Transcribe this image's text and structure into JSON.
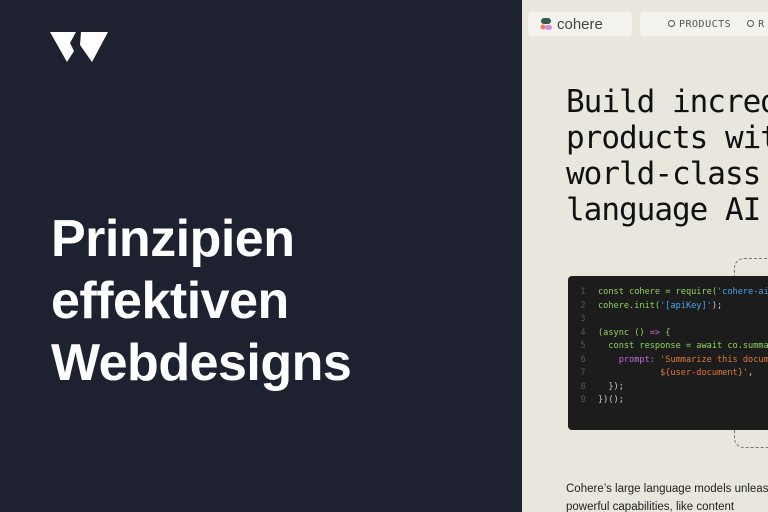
{
  "left": {
    "logo": "W",
    "headline": [
      "Prinzipien",
      "effektiven",
      "Webdesigns"
    ]
  },
  "screenshot": {
    "brand": "cohere",
    "nav": [
      "PRODUCTS",
      "R"
    ],
    "hero": [
      "Build incredi",
      "products with",
      "world-class",
      "language AI"
    ],
    "code": [
      [
        [
          "g",
          "const cohere = require("
        ],
        [
          "b",
          "'cohere-ai'"
        ],
        [
          "w",
          ")"
        ]
      ],
      [
        [
          "g",
          "cohere.init("
        ],
        [
          "b",
          "'[apiKey]'"
        ],
        [
          "w",
          ");"
        ]
      ],
      [],
      [
        [
          "g",
          "(async () "
        ],
        [
          "p",
          "=>"
        ],
        [
          "g",
          " {"
        ]
      ],
      [
        [
          "g",
          "  const response = await co.summari"
        ]
      ],
      [
        [
          "p",
          "    prompt: "
        ],
        [
          "o",
          "'Summarize this documen"
        ]
      ],
      [
        [
          "o",
          "            ${user-document}'"
        ],
        [
          "w",
          ","
        ]
      ],
      [
        [
          "w",
          "  });"
        ]
      ],
      [
        [
          "w",
          "})();"
        ]
      ]
    ],
    "paragraph": [
      "Cohere’s large language models unleas",
      "powerful capabilities, like content"
    ]
  },
  "colors": {
    "background": "#1e2130",
    "panel": "#e8e6dd"
  }
}
